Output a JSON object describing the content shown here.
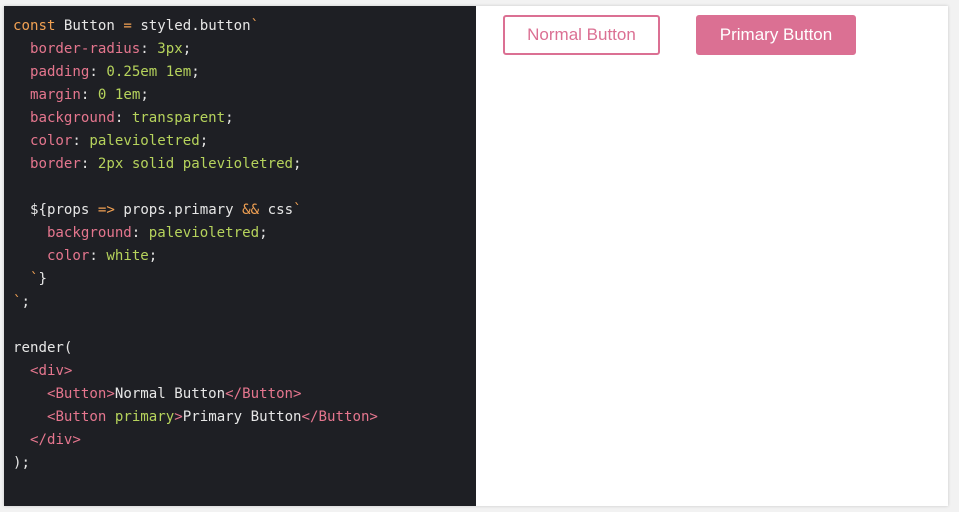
{
  "colors": {
    "accent": "#db7093",
    "editor_bg": "#1e1f24",
    "keyword": "#f1a153",
    "property": "#e5768e",
    "value": "#b6d35c",
    "text": "#e6e6e6",
    "tag": "#e5768e"
  },
  "editor": {
    "lines": [
      [
        [
          "const ",
          "keyword"
        ],
        [
          "Button ",
          "text"
        ],
        [
          "= ",
          "keyword"
        ],
        [
          "styled.button",
          "text"
        ],
        [
          "`",
          "keyword"
        ]
      ],
      [
        [
          "  border-radius",
          "property"
        ],
        [
          ": ",
          "text"
        ],
        [
          "3px",
          "value"
        ],
        [
          ";",
          "text"
        ]
      ],
      [
        [
          "  padding",
          "property"
        ],
        [
          ": ",
          "text"
        ],
        [
          "0.25em 1em",
          "value"
        ],
        [
          ";",
          "text"
        ]
      ],
      [
        [
          "  margin",
          "property"
        ],
        [
          ": ",
          "text"
        ],
        [
          "0 1em",
          "value"
        ],
        [
          ";",
          "text"
        ]
      ],
      [
        [
          "  background",
          "property"
        ],
        [
          ": ",
          "text"
        ],
        [
          "transparent",
          "value"
        ],
        [
          ";",
          "text"
        ]
      ],
      [
        [
          "  color",
          "property"
        ],
        [
          ": ",
          "text"
        ],
        [
          "palevioletred",
          "value"
        ],
        [
          ";",
          "text"
        ]
      ],
      [
        [
          "  border",
          "property"
        ],
        [
          ": ",
          "text"
        ],
        [
          "2px solid palevioletred",
          "value"
        ],
        [
          ";",
          "text"
        ]
      ],
      [],
      [
        [
          "  ${",
          "text"
        ],
        [
          "props ",
          "text"
        ],
        [
          "=> ",
          "keyword"
        ],
        [
          "props.primary ",
          "text"
        ],
        [
          "&& ",
          "keyword"
        ],
        [
          "css",
          "text"
        ],
        [
          "`",
          "keyword"
        ]
      ],
      [
        [
          "    background",
          "property"
        ],
        [
          ": ",
          "text"
        ],
        [
          "palevioletred",
          "value"
        ],
        [
          ";",
          "text"
        ]
      ],
      [
        [
          "    color",
          "property"
        ],
        [
          ": ",
          "text"
        ],
        [
          "white",
          "value"
        ],
        [
          ";",
          "text"
        ]
      ],
      [
        [
          "  `",
          "keyword"
        ],
        [
          "}",
          "text"
        ]
      ],
      [
        [
          "`",
          "keyword"
        ],
        [
          ";",
          "text"
        ]
      ],
      [],
      [
        [
          "render(",
          "text"
        ]
      ],
      [
        [
          "  ",
          "text"
        ],
        [
          "<div>",
          "tag"
        ]
      ],
      [
        [
          "    ",
          "text"
        ],
        [
          "<Button>",
          "tag"
        ],
        [
          "Normal Button",
          "text"
        ],
        [
          "</Button>",
          "tag"
        ]
      ],
      [
        [
          "    ",
          "text"
        ],
        [
          "<Button ",
          "tag"
        ],
        [
          "primary",
          "value"
        ],
        [
          ">",
          "tag"
        ],
        [
          "Primary Button",
          "text"
        ],
        [
          "</Button>",
          "tag"
        ]
      ],
      [
        [
          "  ",
          "text"
        ],
        [
          "</div>",
          "tag"
        ]
      ],
      [
        [
          ");",
          "text"
        ]
      ]
    ]
  },
  "preview": {
    "normal_button_label": "Normal Button",
    "primary_button_label": "Primary Button"
  }
}
